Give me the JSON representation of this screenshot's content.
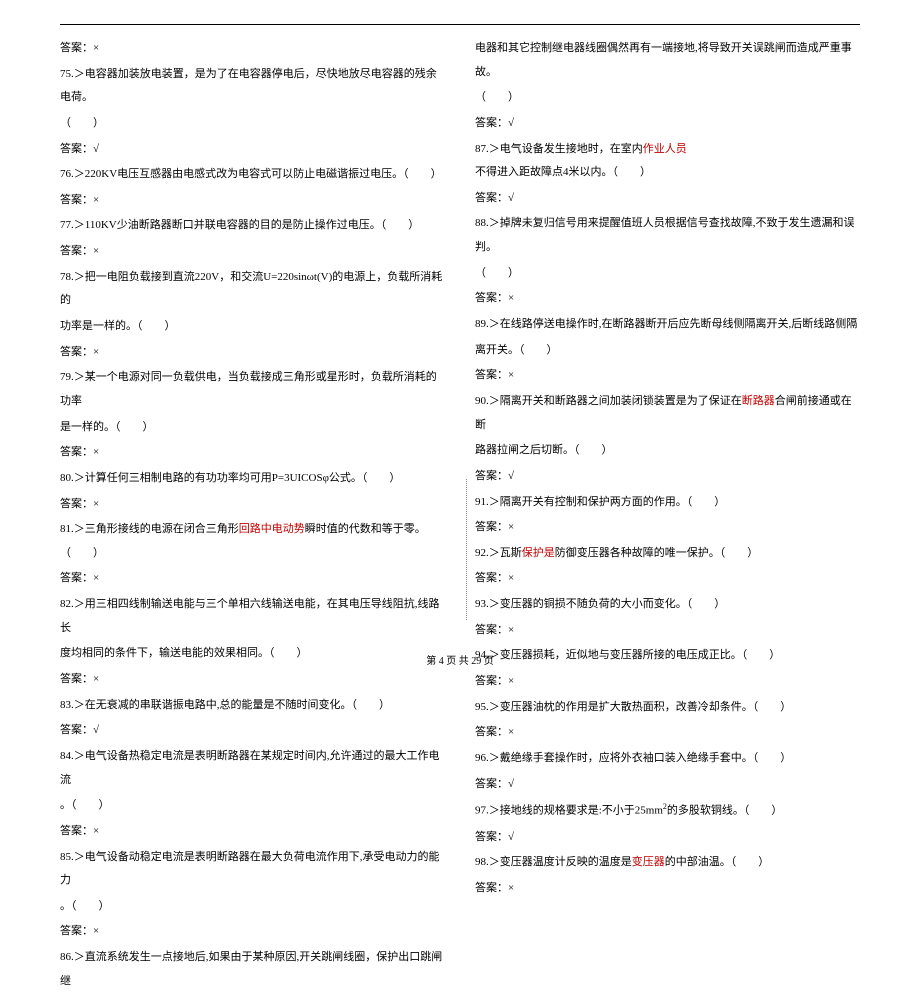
{
  "left": {
    "a74": "答案：×",
    "q75": "75.＞电容器加装放电装置，是为了在电容器停电后，尽快地放尽电容器的残余电荷。",
    "p75": "（　　）",
    "a75": "答案：√",
    "q76": "76.＞220KV电压互感器由电感式改为电容式可以防止电磁谐振过电压。（　　）",
    "a76": "答案：×",
    "q77": "77.＞110KV少油断路器断口并联电容器的目的是防止操作过电压。（　　）",
    "a77": "答案：×",
    "q78a": "78.＞把一电阻负载接到直流220V，和交流U=220sinωt(V)的电源上，负载所消耗的",
    "q78b": "功率是一样的。（　　）",
    "a78": "答案：×",
    "q79a": "79.＞某一个电源对同一负载供电，当负载接成三角形或星形时，负载所消耗的功率",
    "q79b": "是一样的。（　　）",
    "a79": "答案：×",
    "q80": "80.＞计算任何三相制电路的有功功率均可用P=3UICOSφ公式。（　　）",
    "a80": "答案：×",
    "q81_pre": "81.＞三角形接线的电源在闭合三角形",
    "q81_red": "回路中电动势",
    "q81_post": "瞬时值的代数和等于零。（　　）",
    "a81": "答案：×",
    "q82a": "82.＞用三相四线制输送电能与三个单相六线输送电能，在其电压导线阻抗,线路长",
    "q82b": "度均相同的条件下，输送电能的效果相同。（　　）",
    "a82": "答案：×",
    "q83": "83.＞在无衰减的串联谐振电路中,总的能量是不随时间变化。（　　）",
    "a83": "答案：√",
    "q84a": "84.＞电气设备热稳定电流是表明断路器在某规定时间内,允许通过的最大工作电流",
    "q84b": "。（　　）",
    "a84": "答案：×",
    "q85a": "85.＞电气设备动稳定电流是表明断路器在最大负荷电流作用下,承受电动力的能力",
    "q85b": "。（　　）",
    "a85": "答案：×",
    "q86": "86.＞直流系统发生一点接地后,如果由于某种原因,开关跳闸线圈，保护出口跳闸继"
  },
  "right": {
    "r86a": "电器和其它控制继电器线圈偶然再有一端接地,将导致开关误跳闸而造成严重事故。",
    "r86b": "（　　）",
    "a86": "答案：√",
    "q87_pre": "87.＞电气设备发生接地时，在室内",
    "q87_red": "作业人员",
    "q87_post": "不得进入距故障点4米以内。（　　）",
    "a87": "答案：√",
    "q88a": "88.＞掉牌未复归信号用来提醒值班人员根据信号查找故障,不致于发生遗漏和误判。",
    "q88b": "（　　）",
    "a88": "答案：×",
    "q89a": "89.＞在线路停送电操作时,在断路器断开后应先断母线侧隔离开关,后断线路侧隔",
    "q89b": "离开关。（　　）",
    "a89": "答案：×",
    "q90_pre": "90.＞隔离开关和断路器之间加装闭锁装置是为了保证在",
    "q90_red": "断路器",
    "q90_posta": "合闸前接通或在断",
    "q90_postb": "路器拉闸之后切断。（　　）",
    "a90": "答案：√",
    "q91": "91.＞隔离开关有控制和保护两方面的作用。（　　）",
    "a91": "答案：×",
    "q92_pre": "92.＞瓦斯",
    "q92_red": "保护是",
    "q92_post": "防御变压器各种故障的唯一保护。（　　）",
    "a92": "答案：×",
    "q93": "93.＞变压器的铜损不随负荷的大小而变化。（　　）",
    "a93": "答案：×",
    "q94": "94.＞变压器损耗，近似地与变压器所接的电压成正比。（　　）",
    "a94": "答案：×",
    "q95": "95.＞变压器油枕的作用是扩大散热面积，改善冷却条件。（　　）",
    "a95": "答案：×",
    "q96": "96.＞戴绝缘手套操作时，应将外衣袖口装入绝缘手套中。（　　）",
    "a96": "答案：√",
    "q97_pre": "97.＞接地线的规格要求是:不小于25mm",
    "q97_sup": "2",
    "q97_post": "的多股软铜线。（　　）",
    "a97": "答案：√",
    "q98_pre": "98.＞变压器温度计反映的温度是",
    "q98_red": "变压器",
    "q98_post": "的中部油温。（　　）",
    "a98": "答案：×"
  },
  "footer": "第 4 页 共 29 页"
}
